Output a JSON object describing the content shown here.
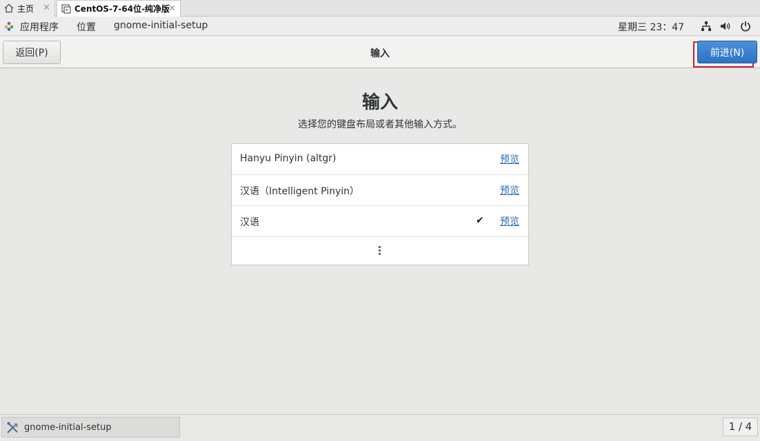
{
  "vm_tabs": [
    {
      "label": "主页",
      "icon": "home-icon"
    },
    {
      "label": "CentOS-7-64位-纯净版",
      "icon": "vm-icon"
    }
  ],
  "topbar": {
    "applications": "应用程序",
    "places": "位置",
    "app_name": "gnome-initial-setup",
    "clock": "星期三 23：47"
  },
  "header": {
    "back_label": "返回(P)",
    "title": "输入",
    "next_label": "前进(N)"
  },
  "main": {
    "title": "输入",
    "subtitle": "选择您的键盘布局或者其他输入方式。",
    "inputs": [
      {
        "name": "Hanyu Pinyin (altgr)",
        "preview": "预览",
        "selected": false
      },
      {
        "name": "汉语（Intelligent Pinyin）",
        "preview": "预览",
        "selected": false
      },
      {
        "name": "汉语",
        "preview": "预览",
        "selected": true
      }
    ],
    "check_mark": "✔"
  },
  "taskbar": {
    "task_label": "gnome-initial-setup",
    "pager": "1 / 4"
  },
  "colors": {
    "accent": "#2d74c6",
    "highlight_border": "#d0202c",
    "link": "#2a6eb8"
  }
}
